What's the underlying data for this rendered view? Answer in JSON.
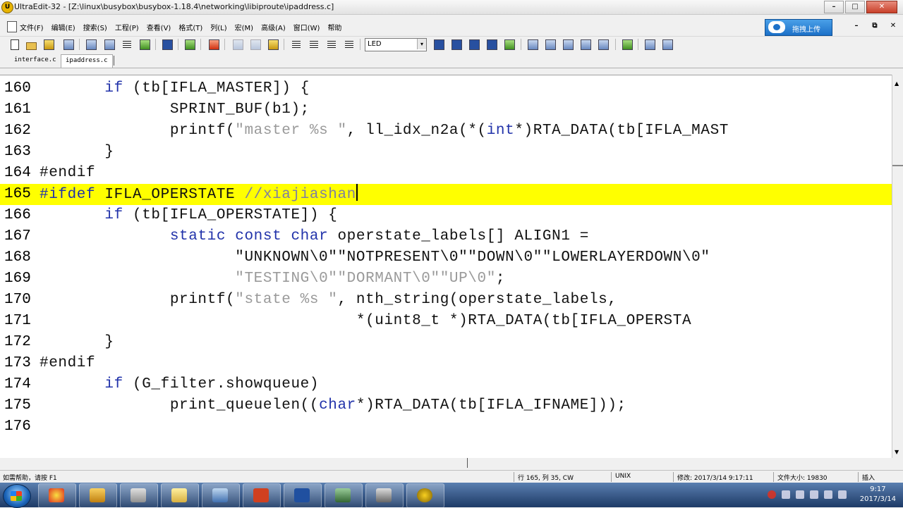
{
  "window": {
    "title": "UltraEdit-32 - [Z:\\linux\\busybox\\busybox-1.18.4\\networking\\libiproute\\ipaddress.c]",
    "app_icon_text": "U",
    "min_label": "–",
    "max_label": "□",
    "close_label": "✕"
  },
  "menubar": {
    "items": [
      "文件(F)",
      "编辑(E)",
      "搜索(S)",
      "工程(P)",
      "查看(V)",
      "格式(T)",
      "列(L)",
      "宏(M)",
      "高级(A)",
      "窗口(W)",
      "帮助"
    ],
    "cloud_button": "拖拽上传",
    "mdi_min": "–",
    "mdi_restore": "⧉",
    "mdi_close": "✕"
  },
  "toolbar": {
    "font_value": "LED",
    "font_arrow": "▾"
  },
  "tabs": [
    "interface.c",
    "ipaddress.c"
  ],
  "editor": {
    "lines": [
      {
        "no": "160",
        "code": "       if (tb[IFLA_MASTER]) {"
      },
      {
        "no": "161",
        "code": "              SPRINT_BUF(b1);"
      },
      {
        "no": "162",
        "code": "              printf(\"master %s \", ll_idx_n2a(*(int*)RTA_DATA(tb[IFLA_MAST"
      },
      {
        "no": "163",
        "code": "       }"
      },
      {
        "no": "164",
        "code": "#endif"
      },
      {
        "no": "165",
        "code": "#ifdef IFLA_OPERSTATE //xiajiashan"
      },
      {
        "no": "166",
        "code": "       if (tb[IFLA_OPERSTATE]) {"
      },
      {
        "no": "167",
        "code": "              static const char operstate_labels[] ALIGN1 ="
      },
      {
        "no": "168",
        "code": "                     \"UNKNOWN\\0\"\"NOTPRESENT\\0\"\"DOWN\\0\"\"LOWERLAYERDOWN\\0\""
      },
      {
        "no": "169",
        "code": "                     \"TESTING\\0\"\"DORMANT\\0\"\"UP\\0\";"
      },
      {
        "no": "170",
        "code": "              printf(\"state %s \", nth_string(operstate_labels,"
      },
      {
        "no": "171",
        "code": "                                  *(uint8_t *)RTA_DATA(tb[IFLA_OPERSTA"
      },
      {
        "no": "172",
        "code": "       }"
      },
      {
        "no": "173",
        "code": "#endif"
      },
      {
        "no": "174",
        "code": "       if (G_filter.showqueue)"
      },
      {
        "no": "175",
        "code": "              print_queuelen((char*)RTA_DATA(tb[IFLA_IFNAME]));"
      },
      {
        "no": "176",
        "code": ""
      }
    ],
    "highlight_line": "165",
    "colors": {
      "highlight": "#ffff00",
      "keyword": "#2233aa",
      "string": "#9a9a9a"
    }
  },
  "statusbar": {
    "help": "如需帮助，请按 F1",
    "position": "行 165, 列 35, CW",
    "line_ending": "UNIX",
    "modified": "修改: 2017/3/14 9:17:11",
    "filesize": "文件大小: 19830",
    "mode": "插入"
  },
  "taskbar": {
    "time": "9:17",
    "date": "2017/3/14",
    "apps": [
      "ppt-icon",
      "word-icon",
      "ultraedit-icon"
    ]
  }
}
